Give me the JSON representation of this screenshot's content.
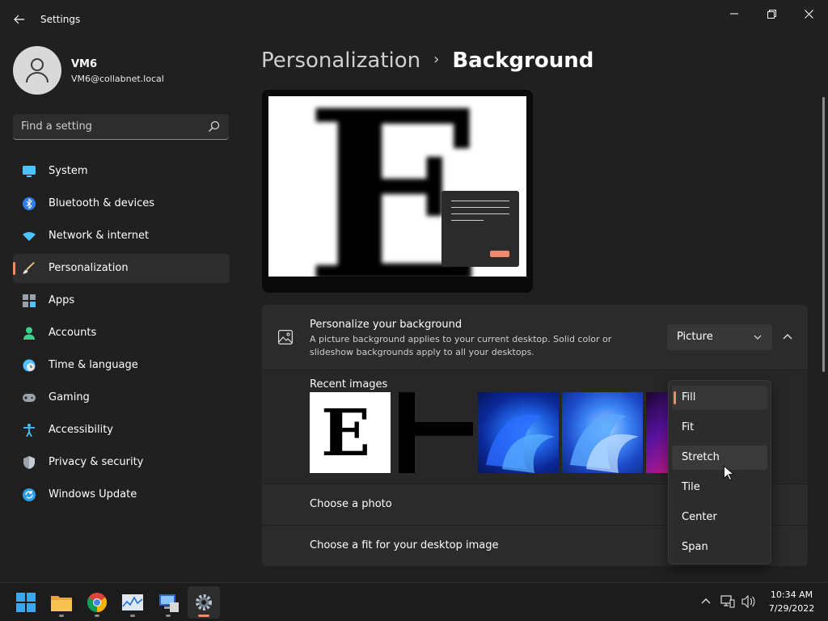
{
  "window": {
    "title": "Settings"
  },
  "profile": {
    "name": "VM6",
    "email": "VM6@collabnet.local"
  },
  "search": {
    "placeholder": "Find a setting"
  },
  "sidebar": {
    "items": [
      {
        "label": "System",
        "icon": "monitor-icon",
        "active": false
      },
      {
        "label": "Bluetooth & devices",
        "icon": "bluetooth-icon",
        "active": false
      },
      {
        "label": "Network & internet",
        "icon": "wifi-icon",
        "active": false
      },
      {
        "label": "Personalization",
        "icon": "brush-icon",
        "active": true
      },
      {
        "label": "Apps",
        "icon": "apps-icon",
        "active": false
      },
      {
        "label": "Accounts",
        "icon": "person-icon",
        "active": false
      },
      {
        "label": "Time & language",
        "icon": "clock-globe-icon",
        "active": false
      },
      {
        "label": "Gaming",
        "icon": "gamepad-icon",
        "active": false
      },
      {
        "label": "Accessibility",
        "icon": "accessibility-icon",
        "active": false
      },
      {
        "label": "Privacy & security",
        "icon": "shield-icon",
        "active": false
      },
      {
        "label": "Windows Update",
        "icon": "update-icon",
        "active": false
      }
    ]
  },
  "breadcrumb": {
    "parent": "Personalization",
    "separator": "›",
    "current": "Background"
  },
  "preview": {
    "letter": "E"
  },
  "background_section": {
    "title": "Personalize your background",
    "description": "A picture background applies to your current desktop. Solid color or slideshow backgrounds apply to all your desktops.",
    "dropdown_value": "Picture",
    "recent_label": "Recent images",
    "thumb_letter": "E",
    "choose_photo": "Choose a photo",
    "choose_fit": "Choose a fit for your desktop image"
  },
  "fit_menu": {
    "options": [
      "Fill",
      "Fit",
      "Stretch",
      "Tile",
      "Center",
      "Span"
    ],
    "selected": "Fill",
    "hovered": "Stretch"
  },
  "taskbar": {
    "time": "10:34 AM",
    "date": "7/29/2022"
  },
  "colors": {
    "accent": "#f08a6c",
    "background": "#202020",
    "card": "#2b2b2b"
  }
}
